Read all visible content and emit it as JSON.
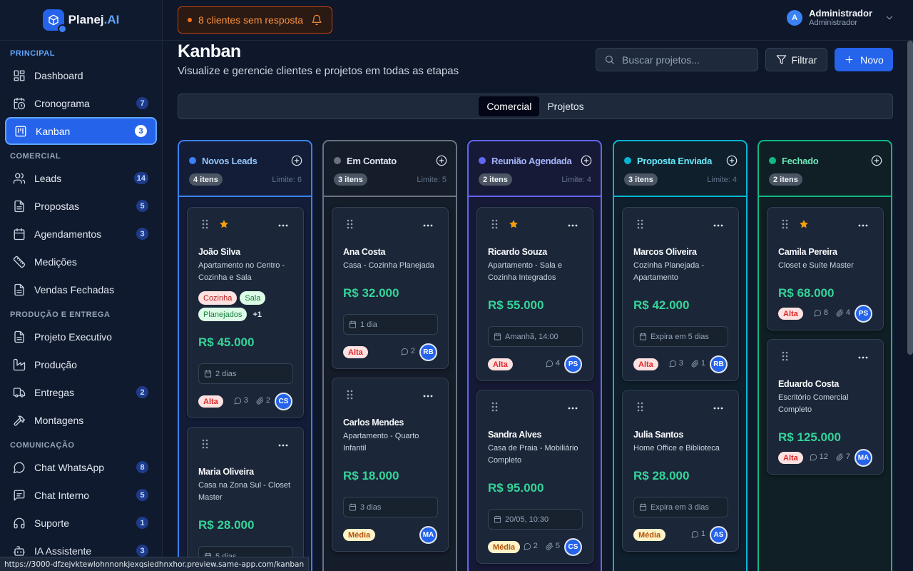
{
  "app": {
    "name": "Planej",
    "name_suffix": ".AI"
  },
  "sidebar": {
    "sections": [
      {
        "title": "Principal",
        "items": [
          {
            "label": "Dashboard",
            "icon": "dashboard-icon",
            "badge": ""
          },
          {
            "label": "Cronograma",
            "icon": "clock-calendar-icon",
            "badge": "7"
          },
          {
            "label": "Kanban",
            "icon": "kanban-icon",
            "badge": "3",
            "active": true
          }
        ]
      },
      {
        "title": "Comercial",
        "items": [
          {
            "label": "Leads",
            "icon": "users-icon",
            "badge": "14"
          },
          {
            "label": "Propostas",
            "icon": "document-icon",
            "badge": "5"
          },
          {
            "label": "Agendamentos",
            "icon": "calendar-icon",
            "badge": "3"
          },
          {
            "label": "Medições",
            "icon": "ruler-icon",
            "badge": ""
          },
          {
            "label": "Vendas Fechadas",
            "icon": "document-icon",
            "badge": ""
          }
        ]
      },
      {
        "title": "Produção e Entrega",
        "items": [
          {
            "label": "Projeto Executivo",
            "icon": "document-icon",
            "badge": ""
          },
          {
            "label": "Produção",
            "icon": "factory-icon",
            "badge": ""
          },
          {
            "label": "Entregas",
            "icon": "truck-icon",
            "badge": "2"
          },
          {
            "label": "Montagens",
            "icon": "hammer-icon",
            "badge": ""
          }
        ]
      },
      {
        "title": "Comunicação",
        "items": [
          {
            "label": "Chat WhatsApp",
            "icon": "message-icon",
            "badge": "8"
          },
          {
            "label": "Chat Interno",
            "icon": "message-lines-icon",
            "badge": "5"
          },
          {
            "label": "Suporte",
            "icon": "headphones-icon",
            "badge": "1"
          },
          {
            "label": "IA Assistente",
            "icon": "bot-icon",
            "badge": "3"
          }
        ]
      }
    ]
  },
  "topbar": {
    "alert": "8 clientes sem resposta",
    "user_initial": "A",
    "user_name": "Administrador",
    "user_role": "Administrador"
  },
  "header": {
    "title": "Kanban",
    "subtitle": "Visualize e gerencie clientes e projetos em todas as etapas",
    "search_placeholder": "Buscar projetos...",
    "filter_label": "Filtrar",
    "new_label": "Novo"
  },
  "tabs": [
    {
      "label": "Comercial",
      "active": true
    },
    {
      "label": "Projetos",
      "active": false
    }
  ],
  "columns": [
    {
      "title": "Novos Leads",
      "color": "#3b82f6",
      "title_color": "#93c5fd",
      "bg": "#131d38",
      "count": "4 itens",
      "limit": "Limite: 6",
      "cards": [
        {
          "name": "João Silva",
          "desc": "Apartamento no Centro - Cozinha e Sala",
          "starred": true,
          "tags": [
            "Cozinha",
            "Sala",
            "Planejados"
          ],
          "tag_more": "+1",
          "value": "R$ 45.000",
          "meta": "2 dias",
          "meta_icon": "calendar-icon",
          "priority": "Alta",
          "comments": "3",
          "attachments": "2",
          "assignee": "CS"
        },
        {
          "name": "Maria Oliveira",
          "desc": "Casa na Zona Sul - Closet Master",
          "starred": false,
          "tags": [],
          "tag_more": "",
          "value": "R$ 28.000",
          "meta": "5 dias",
          "meta_icon": "calendar-icon",
          "priority": "",
          "comments": "",
          "attachments": "",
          "assignee": ""
        }
      ]
    },
    {
      "title": "Em Contato",
      "color": "#6b7280",
      "title_color": "#e2e8f0",
      "bg": "#151c2a",
      "count": "3 itens",
      "limit": "Limite: 5",
      "cards": [
        {
          "name": "Ana Costa",
          "desc": "Casa - Cozinha Planejada",
          "starred": false,
          "tags": [],
          "tag_more": "",
          "value": "R$ 32.000",
          "meta": "1 dia",
          "meta_icon": "calendar-icon",
          "priority": "Alta",
          "comments": "2",
          "attachments": "",
          "assignee": "RB"
        },
        {
          "name": "Carlos Mendes",
          "desc": "Apartamento - Quarto Infantil",
          "starred": false,
          "tags": [],
          "tag_more": "",
          "value": "R$ 18.000",
          "meta": "3 dias",
          "meta_icon": "calendar-icon",
          "priority": "Média",
          "comments": "",
          "attachments": "",
          "assignee": "MA"
        }
      ]
    },
    {
      "title": "Reunião Agendada",
      "color": "#6366f1",
      "title_color": "#a5b4fc",
      "bg": "#171a36",
      "count": "2 itens",
      "limit": "Limite: 4",
      "cards": [
        {
          "name": "Ricardo Souza",
          "desc": "Apartamento - Sala e Cozinha Integrados",
          "starred": true,
          "tags": [],
          "tag_more": "",
          "value": "R$ 55.000",
          "meta": "Amanhã, 14:00",
          "meta_icon": "calendar-icon",
          "priority": "Alta",
          "comments": "4",
          "attachments": "",
          "assignee": "PS"
        },
        {
          "name": "Sandra Alves",
          "desc": "Casa de Praia - Mobiliário Completo",
          "starred": false,
          "tags": [],
          "tag_more": "",
          "value": "R$ 95.000",
          "meta": "20/05, 10:30",
          "meta_icon": "calendar-icon",
          "priority": "Média",
          "comments": "2",
          "attachments": "5",
          "assignee": "CS"
        }
      ]
    },
    {
      "title": "Proposta Enviada",
      "color": "#06b6d4",
      "title_color": "#67e8f9",
      "bg": "#0f1f2c",
      "count": "3 itens",
      "limit": "Limite: 4",
      "cards": [
        {
          "name": "Marcos Oliveira",
          "desc": "Cozinha Planejada - Apartamento",
          "starred": false,
          "tags": [],
          "tag_more": "",
          "value": "R$ 42.000",
          "meta": "Expira em 5 dias",
          "meta_icon": "calendar-icon",
          "priority": "Alta",
          "comments": "3",
          "attachments": "1",
          "assignee": "RB"
        },
        {
          "name": "Julia Santos",
          "desc": "Home Office e Biblioteca",
          "starred": false,
          "tags": [],
          "tag_more": "",
          "value": "R$ 28.000",
          "meta": "Expira em 3 dias",
          "meta_icon": "calendar-icon",
          "priority": "Média",
          "comments": "1",
          "attachments": "",
          "assignee": "AS"
        }
      ]
    },
    {
      "title": "Fechado",
      "color": "#10b981",
      "title_color": "#6ee7b7",
      "bg": "#0f1f25",
      "count": "2 itens",
      "limit": "",
      "cards": [
        {
          "name": "Camila Pereira",
          "desc": "Closet e Suíte Master",
          "starred": true,
          "tags": [],
          "tag_more": "",
          "value": "R$ 68.000",
          "meta": "",
          "meta_icon": "",
          "priority": "Alta",
          "comments": "8",
          "attachments": "4",
          "assignee": "PS"
        },
        {
          "name": "Eduardo Costa",
          "desc": "Escritório Comercial Completo",
          "starred": false,
          "tags": [],
          "tag_more": "",
          "value": "R$ 125.000",
          "meta": "",
          "meta_icon": "",
          "priority": "Alta",
          "comments": "12",
          "attachments": "7",
          "assignee": "MA"
        }
      ]
    }
  ],
  "status_url": "https://3000-dfzejvktewlohnnonkjexqsiedhnxhor.preview.same-app.com/kanban"
}
